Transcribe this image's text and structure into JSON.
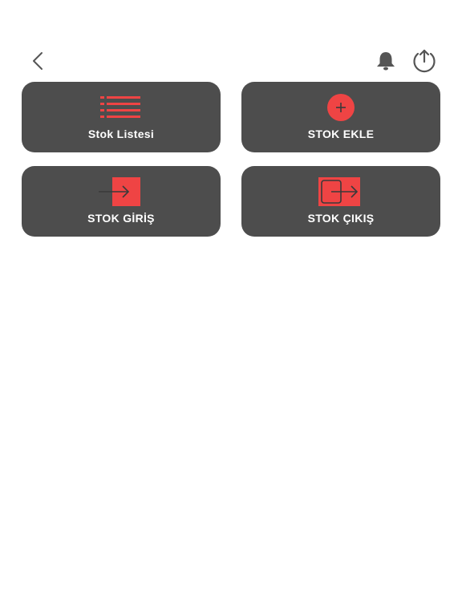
{
  "header": {
    "back_icon": "chevron-left-icon",
    "notifications_icon": "bell-icon",
    "upload_icon": "upload-circle-icon"
  },
  "tiles": [
    {
      "label": "Stok Listesi",
      "icon": "list-icon"
    },
    {
      "label": "STOK EKLE",
      "icon": "plus-circle-icon"
    },
    {
      "label": "STOK GİRİŞ",
      "icon": "login-arrow-icon"
    },
    {
      "label": "STOK ÇIKIŞ",
      "icon": "logout-arrow-icon"
    }
  ],
  "colors": {
    "tile_background": "#4d4d4d",
    "accent": "#ef4444",
    "icon_gray": "#555555",
    "text": "#ffffff"
  }
}
